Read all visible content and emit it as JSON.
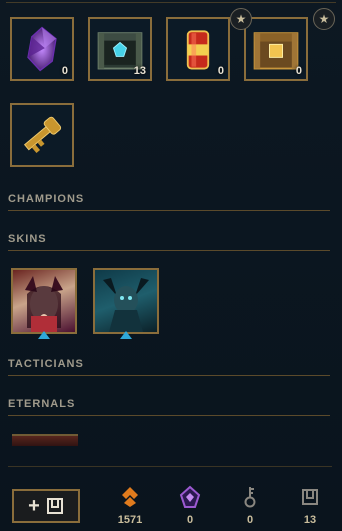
{
  "loot_row1": [
    {
      "name": "gemstone",
      "count": "0"
    },
    {
      "name": "hextech-chest",
      "count": "13"
    },
    {
      "name": "capsule",
      "count": "0",
      "badge_icon": "star-icon"
    },
    {
      "name": "masterwork-chest",
      "count": "0",
      "badge_icon": "star-icon"
    }
  ],
  "loot_row2": [
    {
      "name": "key-fragment"
    }
  ],
  "sections": {
    "champions": "CHAMPIONS",
    "skins": "SKINS",
    "tacticians": "TACTICIANS",
    "eternals": "ETERNALS"
  },
  "skins": [
    {
      "name": "ahri-skin"
    },
    {
      "name": "dark-creature-skin"
    }
  ],
  "footer": {
    "craft_plus": "+",
    "currencies": [
      {
        "icon": "blue-essence-icon",
        "value": "1571",
        "color": "#e07b1d"
      },
      {
        "icon": "mythic-essence-icon",
        "value": "0",
        "color": "#9b59d0"
      },
      {
        "icon": "key-icon",
        "value": "0",
        "color": "#8a8780"
      },
      {
        "icon": "chest-icon",
        "value": "13",
        "color": "#8a8780"
      }
    ]
  }
}
